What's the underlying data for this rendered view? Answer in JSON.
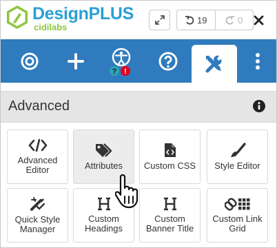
{
  "header": {
    "brand_name": "DesignPLUS",
    "brand_sub": "cidilabs",
    "undo_count": "19",
    "redo_count": "0"
  },
  "toolbar": {
    "tools": [
      "target-icon",
      "plus-icon",
      "accessibility-icon",
      "help-icon",
      "tools-icon",
      "more-icon"
    ],
    "active": "tools-icon",
    "accessibility_badges": [
      "?",
      "!"
    ]
  },
  "section": {
    "title": "Advanced"
  },
  "tiles": [
    {
      "label_line1": "Advanced",
      "label_line2": "Editor",
      "icon": "code-icon"
    },
    {
      "label_line1": "Attributes",
      "label_line2": "",
      "icon": "tags-icon"
    },
    {
      "label_line1": "Custom CSS",
      "label_line2": "",
      "icon": "css-file-icon"
    },
    {
      "label_line1": "Style Editor",
      "label_line2": "",
      "icon": "paintbrush-icon"
    },
    {
      "label_line1": "Quick Style",
      "label_line2": "Manager",
      "icon": "magic-tools-icon"
    },
    {
      "label_line1": "Custom",
      "label_line2": "Headings",
      "icon": "heading-icon"
    },
    {
      "label_line1": "Custom",
      "label_line2": "Banner Title",
      "icon": "heading-icon"
    },
    {
      "label_line1": "Custom Link",
      "label_line2": "Grid",
      "icon": "link-grid-icon"
    }
  ],
  "colors": {
    "toolbar": "#2f7bbd",
    "brand": "#2a9fd6",
    "accent_green": "#8dc63f",
    "alert_red": "#e3001b",
    "help_teal": "#2aa3b6"
  }
}
